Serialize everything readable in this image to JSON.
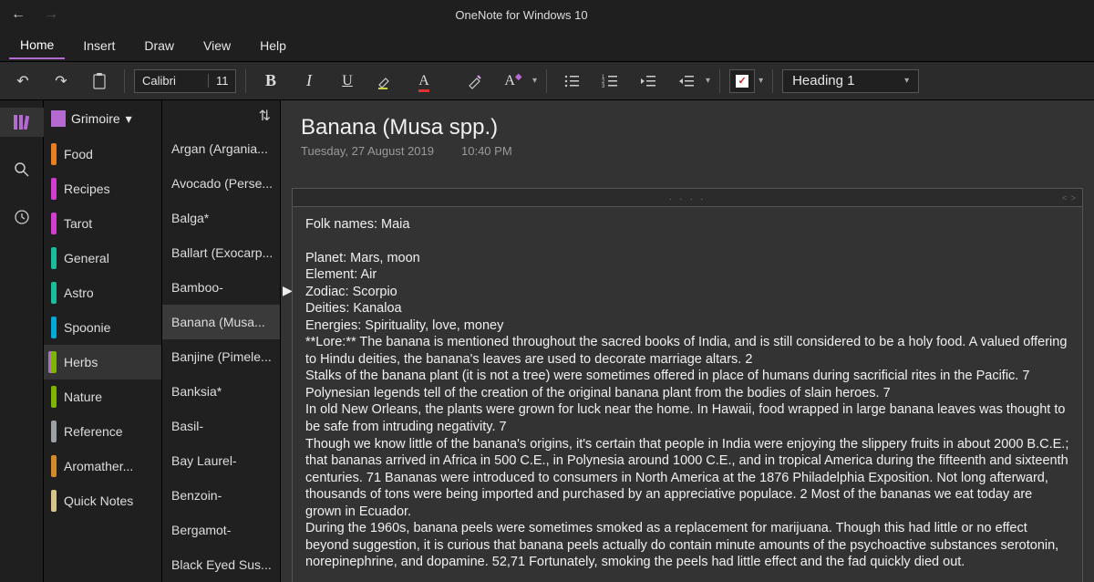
{
  "app": {
    "title": "OneNote for Windows 10"
  },
  "tabs": {
    "home": "Home",
    "insert": "Insert",
    "draw": "Draw",
    "view": "View",
    "help": "Help"
  },
  "ribbon": {
    "font_name": "Calibri",
    "font_size": "11",
    "style": "Heading 1"
  },
  "notebook": {
    "name": "Grimoire"
  },
  "sections": [
    {
      "label": "Food",
      "color": "#e67e22"
    },
    {
      "label": "Recipes",
      "color": "#d23ccf"
    },
    {
      "label": "Tarot",
      "color": "#d23ccf"
    },
    {
      "label": "General",
      "color": "#1abc9c"
    },
    {
      "label": "Astro",
      "color": "#1abc9c"
    },
    {
      "label": "Spoonie",
      "color": "#00a8d6"
    },
    {
      "label": "Herbs",
      "color": "#7db500"
    },
    {
      "label": "Nature",
      "color": "#7db500"
    },
    {
      "label": "Reference",
      "color": "#9aa0a6"
    },
    {
      "label": "Aromather...",
      "color": "#d28a2c"
    },
    {
      "label": "Quick Notes",
      "color": "#d6c48a"
    }
  ],
  "pages": [
    "Argan (Argania...",
    "Avocado (Perse...",
    "Balga*",
    "Ballart (Exocarp...",
    "Bamboo-",
    "Banana (Musa...",
    "Banjine (Pimele...",
    "Banksia*",
    "Basil-",
    "Bay Laurel-",
    "Benzoin-",
    "Bergamot-",
    "Black Eyed Sus..."
  ],
  "active_page_index": 5,
  "page_content": {
    "title": "Banana (Musa spp.)",
    "date": "Tuesday, 27 August 2019",
    "time": "10:40 PM",
    "folk": "Folk names: Maia",
    "planet": "Planet: Mars, moon",
    "element": "Element: Air",
    "zodiac": "Zodiac: Scorpio",
    "deities": "Deities: Kanaloa",
    "energies": "Energies: Spirituality, love, money",
    "lore1": "**Lore:** The banana is mentioned throughout the sacred books of India, and is still considered to be a holy food. A valued offering to Hindu deities, the banana's leaves are used to decorate marriage altars. 2",
    "lore2": "Stalks of the banana plant (it is not a tree) were sometimes offered in place of humans during sacrificial rites in the Pacific. 7 Polynesian legends tell of the creation of the original banana plant from the bodies of slain heroes. 7",
    "lore3": "In old New Orleans, the plants were grown for luck near the home. In Hawaii, food wrapped in large banana leaves was thought to be safe from intruding negativity. 7",
    "lore4": "Though we know little of the banana's origins, it's certain that people in India were enjoying the slippery fruits in about 2000 B.C.E.; that bananas arrived in Africa in 500 C.E., in Polynesia around 1000 C.E., and in tropical America during the fifteenth and sixteenth centuries. 71 Bananas were introduced to consumers in North America at the 1876 Philadelphia Exposition. Not long afterward, thousands of tons were being imported and purchased by an appreciative populace. 2 Most of the bananas we eat today are grown in Ecuador.",
    "lore5": "During the 1960s, banana peels were sometimes smoked as a replacement for marijuana. Though this had little or no effect beyond suggestion, it is curious that banana peels actually do contain minute amounts of the psychoactive substances serotonin, norepinephrine, and dopamine. 52,71 Fortunately, smoking the peels had little effect and the fad quickly died out."
  }
}
